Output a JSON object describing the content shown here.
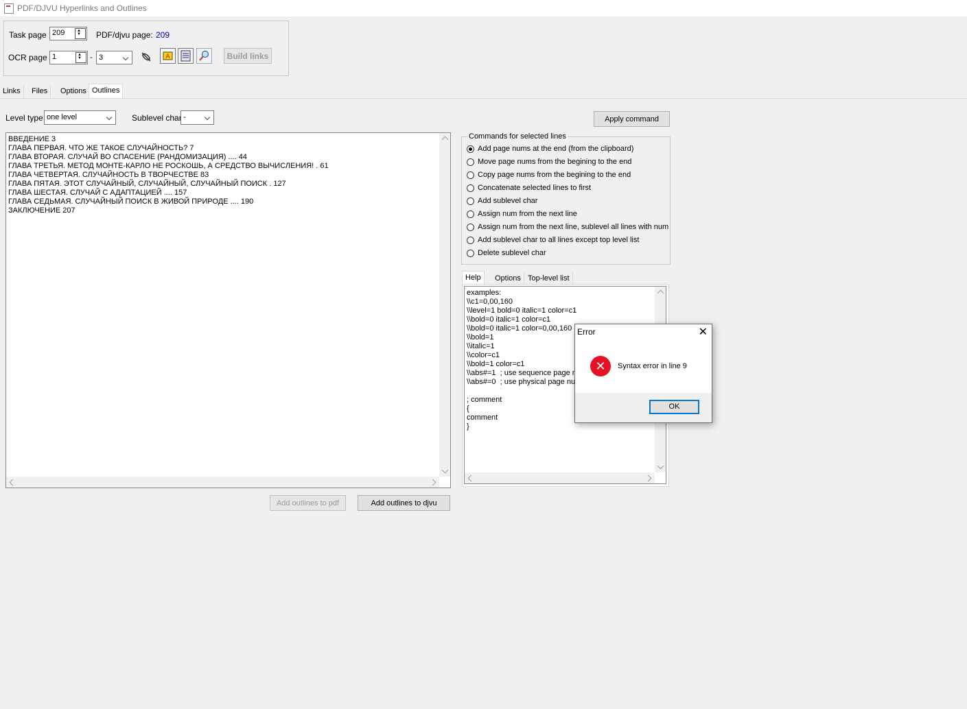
{
  "window": {
    "title": "PDF/DJVU Hyperlinks and Outlines"
  },
  "top": {
    "task_page_label": "Task page",
    "task_page_value": "209",
    "pdf_page_label": "PDF/djvu page:",
    "pdf_page_value": "209",
    "ocr_page_label": "OCR page",
    "ocr_from_value": "1",
    "ocr_dash": "-",
    "ocr_to_value": "3",
    "build_links_label": "Build links"
  },
  "tabs": [
    "Links",
    "Files",
    "Options",
    "Outlines"
  ],
  "outlines": {
    "level_type_label": "Level type",
    "level_type_value": "one level",
    "sublevel_char_label": "Sublevel char",
    "sublevel_char_value": "-",
    "apply_command_label": "Apply command",
    "lines": [
      "ВВЕДЕНИЕ 3",
      "ГЛАВА ПЕРВАЯ. ЧТО ЖЕ ТАКОЕ СЛУЧАЙНОСТЬ? 7",
      "ГЛАВА ВТОРАЯ. СЛУЧАЙ ВО СПАСЕНИЕ (РАНДОМИЗАЦИЯ) .... 44",
      "ГЛАВА ТРЕТЬЯ. МЕТОД МОНТЕ-КАРЛО НЕ РОСКОШЬ, А СРЕДСТВО ВЫЧИСЛЕНИЯ! . 61",
      "ГЛАВА ЧЕТВЕРТАЯ. СЛУЧАЙНОСТЬ В ТВОРЧЕСТВЕ 83",
      "ГЛАВА ПЯТАЯ. ЭТОТ СЛУЧАЙНЫЙ, СЛУЧАЙНЫЙ, СЛУЧАЙНЫЙ ПОИСК . 127",
      "ГЛАВА ШЕСТАЯ. СЛУЧАЙ С АДАПТАЦИЕЙ .... 157",
      "ГЛАВА СЕДЬМАЯ. СЛУЧАЙНЫЙ ПОИСК В ЖИВОЙ ПРИРОДЕ .... 190",
      "ЗАКЛЮЧЕНИЕ 207"
    ],
    "add_pdf_label": "Add outlines to pdf",
    "add_djvu_label": "Add outlines to djvu"
  },
  "commands": {
    "group_title": "Commands for selected lines",
    "options": [
      "Add page nums at the end (from the clipboard)",
      "Move page nums from the begining to the end",
      "Copy page nums from the begining to the end",
      "Concatenate selected lines to first",
      "Add sublevel char",
      "Assign num from the next line",
      "Assign num from the next line, sublevel all lines with num",
      "Add sublevel char to all lines except top level list",
      "Delete sublevel char"
    ],
    "selected_index": 0
  },
  "help": {
    "tabs": [
      "Help",
      "Options",
      "Top-level list"
    ],
    "lines": [
      "examples:",
      "\\\\c1=0,00,160",
      "\\\\level=1 bold=0 italic=1 color=c1",
      "\\\\bold=0 italic=1 color=c1",
      "\\\\bold=0 italic=1 color=0,00,160",
      "\\\\bold=1",
      "\\\\italic=1",
      "\\\\color=c1",
      "\\\\bold=1 color=c1",
      "\\\\abs#=1  ; use sequence page n",
      "\\\\abs#=0  ; use physical page nu",
      "",
      "; comment",
      "{",
      "comment",
      "}"
    ]
  },
  "dialog": {
    "title": "Error",
    "close": "✕",
    "message": "Syntax error in line 9",
    "ok_label": "OK",
    "error_glyph": "✕"
  },
  "colors": {
    "accent": "#0078d7",
    "link_value": "#0000c0",
    "error": "#e81123"
  }
}
